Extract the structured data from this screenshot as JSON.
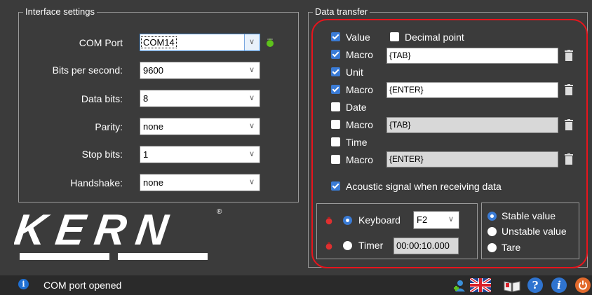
{
  "interface_settings": {
    "title": "Interface settings",
    "com_port": {
      "label": "COM Port",
      "value": "COM14"
    },
    "bits_per_second": {
      "label": "Bits per second:",
      "value": "9600"
    },
    "data_bits": {
      "label": "Data bits:",
      "value": "8"
    },
    "parity": {
      "label": "Parity:",
      "value": "none"
    },
    "stop_bits": {
      "label": "Stop bits:",
      "value": "1"
    },
    "handshake": {
      "label": "Handshake:",
      "value": "none"
    }
  },
  "logo": {
    "text": "KERN"
  },
  "data_transfer": {
    "title": "Data transfer",
    "value": {
      "label": "Value",
      "checked": true
    },
    "decimal_point": {
      "label": "Decimal point",
      "checked": false
    },
    "macro1": {
      "label": "Macro",
      "checked": true,
      "text": "{TAB}"
    },
    "unit": {
      "label": "Unit",
      "checked": true
    },
    "macro2": {
      "label": "Macro",
      "checked": true,
      "text": "{ENTER}"
    },
    "date": {
      "label": "Date",
      "checked": false
    },
    "macro3": {
      "label": "Macro",
      "checked": false,
      "text": "{TAB}"
    },
    "time": {
      "label": "Time",
      "checked": false
    },
    "macro4": {
      "label": "Macro",
      "checked": false,
      "text": "{ENTER}"
    },
    "acoustic": {
      "label": "Acoustic signal when receiving data",
      "checked": true
    }
  },
  "trigger": {
    "keyboard": {
      "label": "Keyboard",
      "selected": true,
      "key": "F2"
    },
    "timer": {
      "label": "Timer",
      "selected": false,
      "value": "00:00:10.000"
    }
  },
  "value_type": {
    "stable": {
      "label": "Stable value",
      "selected": true
    },
    "unstable": {
      "label": "Unstable value",
      "selected": false
    },
    "tare": {
      "label": "Tare",
      "selected": false
    }
  },
  "status": {
    "text": "COM port opened"
  },
  "colors": {
    "background": "#3b3b3b",
    "accent": "#3a7bd5",
    "highlight": "#e8141c",
    "led_green": "#5ec21c",
    "led_red": "#e03030"
  }
}
